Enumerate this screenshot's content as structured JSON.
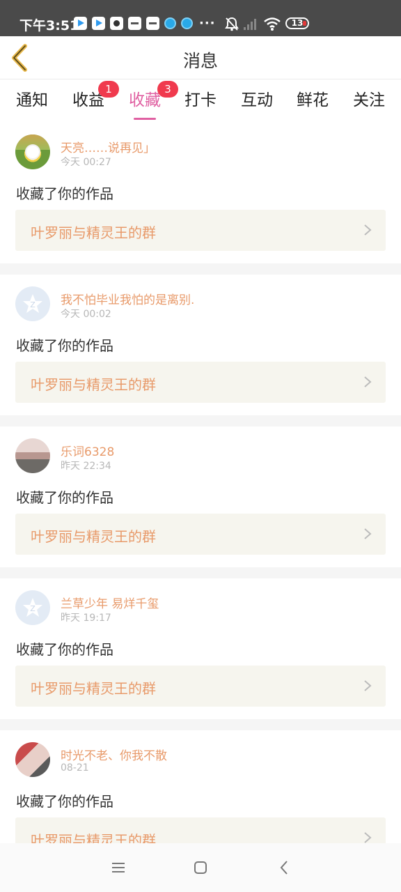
{
  "status_bar": {
    "time": "下午3:51",
    "battery": "13",
    "more": "···",
    "icons": [
      "play-store-icon",
      "play-store-icon",
      "paw-icon",
      "mi-icon",
      "mi-icon",
      "bubble-icon",
      "bubble-icon",
      "more-icon",
      "bell-muted-icon",
      "signal-icon",
      "wifi-icon",
      "battery-icon"
    ]
  },
  "header": {
    "title": "消息",
    "back_icon": "back-chevron-icon",
    "accent": "#e8b84a"
  },
  "tabs": [
    {
      "label": "通知"
    },
    {
      "label": "收益",
      "badge": "1"
    },
    {
      "label": "收藏",
      "badge": "3",
      "active": true
    },
    {
      "label": "打卡"
    },
    {
      "label": "互动"
    },
    {
      "label": "鲜花"
    },
    {
      "label": "关注"
    }
  ],
  "colors": {
    "active_tab": "#e060a2",
    "badge": "#f03a4e",
    "name": "#e89a6a",
    "card_bg": "#f6f5ee"
  },
  "items": [
    {
      "name": "天亮……说再见」",
      "time": "今天 00:27",
      "action": "收藏了你的作品",
      "work": "叶罗丽与精灵王的群",
      "avatar": "flower-avatar"
    },
    {
      "name": "我不怕毕业我怕的是离别.",
      "time": "今天 00:02",
      "action": "收藏了你的作品",
      "work": "叶罗丽与精灵王的群",
      "avatar": "default-avatar"
    },
    {
      "name": "乐词6328",
      "time": "昨天 22:34",
      "action": "收藏了你的作品",
      "work": "叶罗丽与精灵王的群",
      "avatar": "photo-avatar"
    },
    {
      "name": "兰草少年 易烊千玺",
      "time": "昨天 19:17",
      "action": "收藏了你的作品",
      "work": "叶罗丽与精灵王的群",
      "avatar": "default-avatar"
    },
    {
      "name": "时光不老、你我不散",
      "time": "08-21",
      "action": "收藏了你的作品",
      "work": "叶罗丽与精灵王的群",
      "avatar": "photo-avatar"
    }
  ],
  "navbar": {
    "icons": [
      "menu-icon",
      "home-square-icon",
      "back-icon"
    ]
  }
}
